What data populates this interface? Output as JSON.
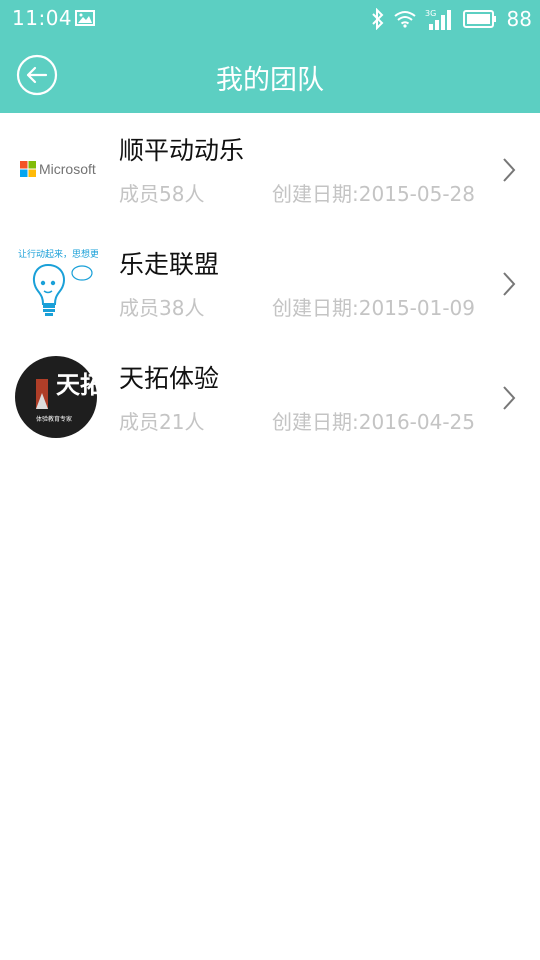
{
  "status_bar": {
    "time": "11:04",
    "battery": "88",
    "network": "3G",
    "icons": [
      "gallery-icon",
      "bluetooth-icon",
      "wifi-icon",
      "signal-icon",
      "battery-icon"
    ]
  },
  "app_bar": {
    "title": "我的团队",
    "back_icon": "back-arrow-icon"
  },
  "colors": {
    "accent": "#5ccfc2",
    "primary_text": "#111111",
    "secondary_text": "#c4c4c4",
    "background": "#ffffff"
  },
  "teams": [
    {
      "name": "顺平动动乐",
      "members": "成员58人",
      "created": "创建日期:2015-05-28",
      "logo": "microsoft-logo",
      "logo_text": "Microsoft"
    },
    {
      "name": "乐走联盟",
      "members": "成员38人",
      "created": "创建日期:2015-01-09",
      "logo": "lightbulb-logo",
      "logo_text": "让行动起来，思想更易..."
    },
    {
      "name": "天拓体验",
      "members": "成员21人",
      "created": "创建日期:2016-04-25",
      "logo": "tiantuo-logo",
      "logo_text": "天拓",
      "logo_subtext": "体验教育专家"
    }
  ]
}
